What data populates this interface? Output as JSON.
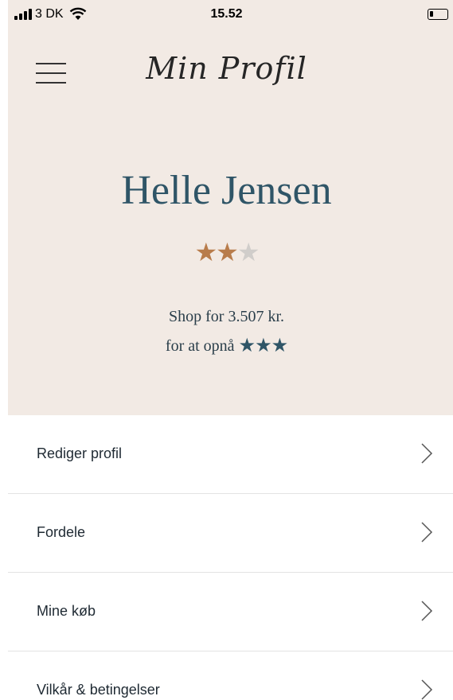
{
  "status_bar": {
    "carrier": "3 DK",
    "time": "15.52",
    "battery_level": 0.15
  },
  "nav": {
    "title": "Min Profil",
    "menu_icon": "hamburger-menu-icon"
  },
  "profile": {
    "name": "Helle Jensen",
    "stars_earned": 2,
    "stars_total": 3,
    "shop_text": "Shop for 3.507 kr.",
    "goal_text": "for at opnå",
    "goal_stars": "★★★"
  },
  "colors": {
    "header_bg": "#f2eae4",
    "name": "#2f5567",
    "star_on": "#b87c4b",
    "star_off": "#d0cdca"
  },
  "menu": {
    "items": [
      {
        "label": "Rediger profil"
      },
      {
        "label": "Fordele"
      },
      {
        "label": "Mine køb"
      },
      {
        "label": "Vilkår & betingelser"
      }
    ]
  }
}
